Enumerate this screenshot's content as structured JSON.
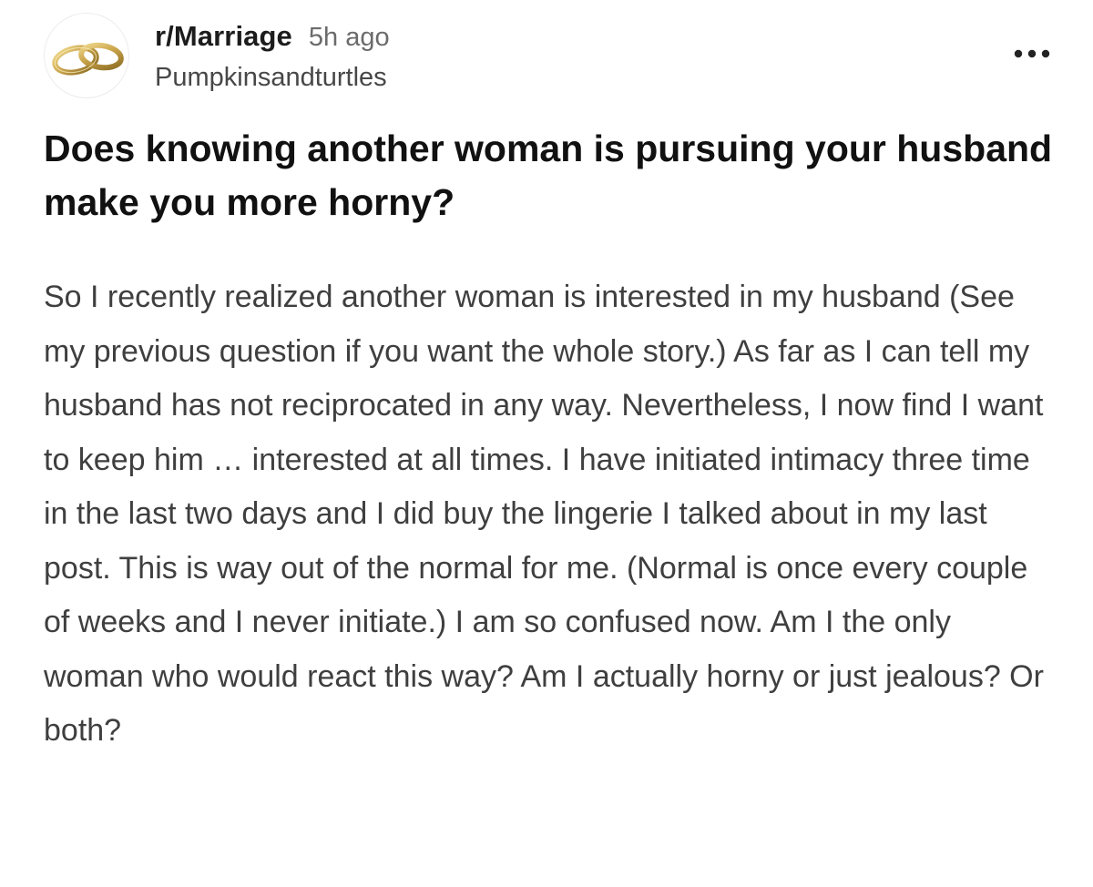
{
  "post": {
    "subreddit": "r/Marriage",
    "time_ago": "5h ago",
    "author": "Pumpkinsandturtles",
    "avatar_icon": "wedding-rings-icon",
    "menu_icon": "more-options-icon",
    "title": "Does knowing another woman is pursuing your husband make you more horny?",
    "body": "So I recently realized another woman is interested in my husband (See my previous question if you want the whole story.) As far as I can tell my husband has not reciprocated in any way. Nevertheless, I now find I want to keep him … interested at all times. I have initiated intimacy three time in the last two days and I did buy the lingerie I talked about in my last post. This is way out of the normal for me. (Normal is once every couple of weeks and I never initiate.) I am so confused now. Am I the only woman who would react this way? Am I actually horny or just jealous? Or both?"
  },
  "colors": {
    "background": "#ffffff",
    "title": "#111111",
    "body_text": "#3f3f3f",
    "timestamp": "#6b6b6b",
    "ring_gold": "#c9a44a"
  }
}
